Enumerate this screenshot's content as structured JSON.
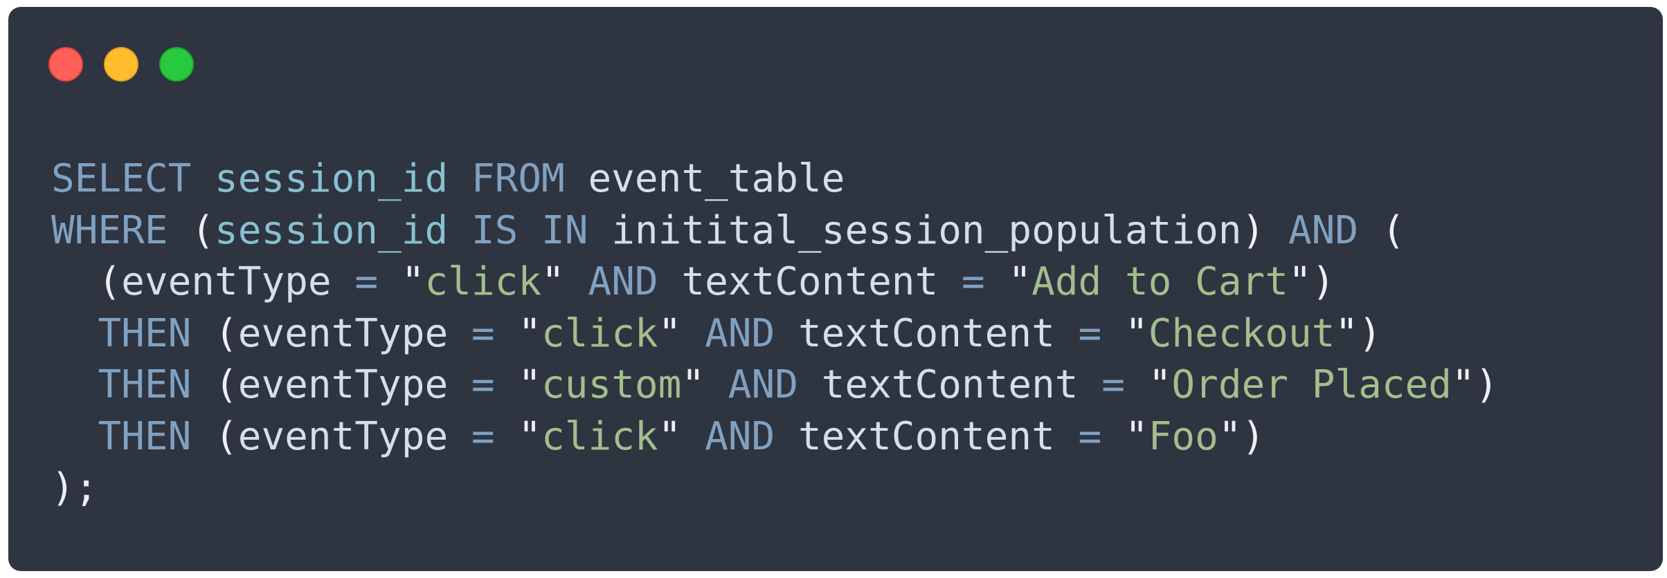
{
  "window": {
    "background": "#2e3440",
    "controls": [
      {
        "name": "close",
        "color": "#ff5f56"
      },
      {
        "name": "minimize",
        "color": "#ffbd2e"
      },
      {
        "name": "maximize",
        "color": "#27c93f"
      }
    ]
  },
  "code": {
    "language": "sql",
    "lines": [
      [
        {
          "t": "keyword",
          "v": "SELECT"
        },
        {
          "t": "ws",
          "v": " "
        },
        {
          "t": "column",
          "v": "session_id"
        },
        {
          "t": "ws",
          "v": " "
        },
        {
          "t": "keyword",
          "v": "FROM"
        },
        {
          "t": "ws",
          "v": " "
        },
        {
          "t": "ident",
          "v": "event_table"
        }
      ],
      [
        {
          "t": "keyword",
          "v": "WHERE"
        },
        {
          "t": "ws",
          "v": " "
        },
        {
          "t": "punct",
          "v": "("
        },
        {
          "t": "column",
          "v": "session_id"
        },
        {
          "t": "ws",
          "v": " "
        },
        {
          "t": "keyword",
          "v": "IS"
        },
        {
          "t": "ws",
          "v": " "
        },
        {
          "t": "keyword",
          "v": "IN"
        },
        {
          "t": "ws",
          "v": " "
        },
        {
          "t": "ident",
          "v": "initital_session_population"
        },
        {
          "t": "punct",
          "v": ")"
        },
        {
          "t": "ws",
          "v": " "
        },
        {
          "t": "keyword",
          "v": "AND"
        },
        {
          "t": "ws",
          "v": " "
        },
        {
          "t": "punct",
          "v": "("
        }
      ],
      [
        {
          "t": "ws",
          "v": "  "
        },
        {
          "t": "punct",
          "v": "("
        },
        {
          "t": "ident",
          "v": "eventType"
        },
        {
          "t": "ws",
          "v": " "
        },
        {
          "t": "op",
          "v": "="
        },
        {
          "t": "ws",
          "v": " "
        },
        {
          "t": "punct",
          "v": "\""
        },
        {
          "t": "string",
          "v": "click"
        },
        {
          "t": "punct",
          "v": "\""
        },
        {
          "t": "ws",
          "v": " "
        },
        {
          "t": "keyword",
          "v": "AND"
        },
        {
          "t": "ws",
          "v": " "
        },
        {
          "t": "ident",
          "v": "textContent"
        },
        {
          "t": "ws",
          "v": " "
        },
        {
          "t": "op",
          "v": "="
        },
        {
          "t": "ws",
          "v": " "
        },
        {
          "t": "punct",
          "v": "\""
        },
        {
          "t": "string",
          "v": "Add to Cart"
        },
        {
          "t": "punct",
          "v": "\""
        },
        {
          "t": "punct",
          "v": ")"
        }
      ],
      [
        {
          "t": "ws",
          "v": "  "
        },
        {
          "t": "keyword",
          "v": "THEN"
        },
        {
          "t": "ws",
          "v": " "
        },
        {
          "t": "punct",
          "v": "("
        },
        {
          "t": "ident",
          "v": "eventType"
        },
        {
          "t": "ws",
          "v": " "
        },
        {
          "t": "op",
          "v": "="
        },
        {
          "t": "ws",
          "v": " "
        },
        {
          "t": "punct",
          "v": "\""
        },
        {
          "t": "string",
          "v": "click"
        },
        {
          "t": "punct",
          "v": "\""
        },
        {
          "t": "ws",
          "v": " "
        },
        {
          "t": "keyword",
          "v": "AND"
        },
        {
          "t": "ws",
          "v": " "
        },
        {
          "t": "ident",
          "v": "textContent"
        },
        {
          "t": "ws",
          "v": " "
        },
        {
          "t": "op",
          "v": "="
        },
        {
          "t": "ws",
          "v": " "
        },
        {
          "t": "punct",
          "v": "\""
        },
        {
          "t": "string",
          "v": "Checkout"
        },
        {
          "t": "punct",
          "v": "\""
        },
        {
          "t": "punct",
          "v": ")"
        }
      ],
      [
        {
          "t": "ws",
          "v": "  "
        },
        {
          "t": "keyword",
          "v": "THEN"
        },
        {
          "t": "ws",
          "v": " "
        },
        {
          "t": "punct",
          "v": "("
        },
        {
          "t": "ident",
          "v": "eventType"
        },
        {
          "t": "ws",
          "v": " "
        },
        {
          "t": "op",
          "v": "="
        },
        {
          "t": "ws",
          "v": " "
        },
        {
          "t": "punct",
          "v": "\""
        },
        {
          "t": "string",
          "v": "custom"
        },
        {
          "t": "punct",
          "v": "\""
        },
        {
          "t": "ws",
          "v": " "
        },
        {
          "t": "keyword",
          "v": "AND"
        },
        {
          "t": "ws",
          "v": " "
        },
        {
          "t": "ident",
          "v": "textContent"
        },
        {
          "t": "ws",
          "v": " "
        },
        {
          "t": "op",
          "v": "="
        },
        {
          "t": "ws",
          "v": " "
        },
        {
          "t": "punct",
          "v": "\""
        },
        {
          "t": "string",
          "v": "Order Placed"
        },
        {
          "t": "punct",
          "v": "\""
        },
        {
          "t": "punct",
          "v": ")"
        }
      ],
      [
        {
          "t": "ws",
          "v": "  "
        },
        {
          "t": "keyword",
          "v": "THEN"
        },
        {
          "t": "ws",
          "v": " "
        },
        {
          "t": "punct",
          "v": "("
        },
        {
          "t": "ident",
          "v": "eventType"
        },
        {
          "t": "ws",
          "v": " "
        },
        {
          "t": "op",
          "v": "="
        },
        {
          "t": "ws",
          "v": " "
        },
        {
          "t": "punct",
          "v": "\""
        },
        {
          "t": "string",
          "v": "click"
        },
        {
          "t": "punct",
          "v": "\""
        },
        {
          "t": "ws",
          "v": " "
        },
        {
          "t": "keyword",
          "v": "AND"
        },
        {
          "t": "ws",
          "v": " "
        },
        {
          "t": "ident",
          "v": "textContent"
        },
        {
          "t": "ws",
          "v": " "
        },
        {
          "t": "op",
          "v": "="
        },
        {
          "t": "ws",
          "v": " "
        },
        {
          "t": "punct",
          "v": "\""
        },
        {
          "t": "string",
          "v": "Foo"
        },
        {
          "t": "punct",
          "v": "\""
        },
        {
          "t": "punct",
          "v": ")"
        }
      ],
      [
        {
          "t": "punct",
          "v": ");"
        }
      ]
    ]
  }
}
